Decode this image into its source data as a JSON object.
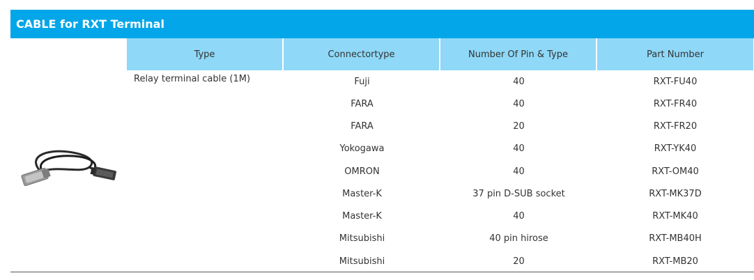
{
  "title": "CABLE for RXT Terminal",
  "table": {
    "headers": {
      "type": "Type",
      "connector": "Connectortype",
      "pins": "Number Of Pin & Type",
      "part": "Part Number"
    },
    "type_value": "Relay terminal cable (1M)",
    "rows": [
      {
        "connector": "Fuji",
        "pins": "40",
        "part": "RXT-FU40"
      },
      {
        "connector": "FARA",
        "pins": "40",
        "part": "RXT-FR40"
      },
      {
        "connector": "FARA",
        "pins": "20",
        "part": "RXT-FR20"
      },
      {
        "connector": "Yokogawa",
        "pins": "40",
        "part": "RXT-YK40"
      },
      {
        "connector": "OMRON",
        "pins": "40",
        "part": "RXT-OM40"
      },
      {
        "connector": "Master-K",
        "pins": "37 pin D-SUB socket",
        "part": "RXT-MK37D"
      },
      {
        "connector": "Master-K",
        "pins": "40",
        "part": "RXT-MK40"
      },
      {
        "connector": "Mitsubishi",
        "pins": "40 pin hirose",
        "part": "RXT-MB40H"
      },
      {
        "connector": "Mitsubishi",
        "pins": "20",
        "part": "RXT-MB20"
      }
    ]
  },
  "colors": {
    "title_bar": "#03a6e8",
    "header_cells": "#8fd8f7"
  },
  "icons": {
    "product_image": "cable-icon"
  }
}
